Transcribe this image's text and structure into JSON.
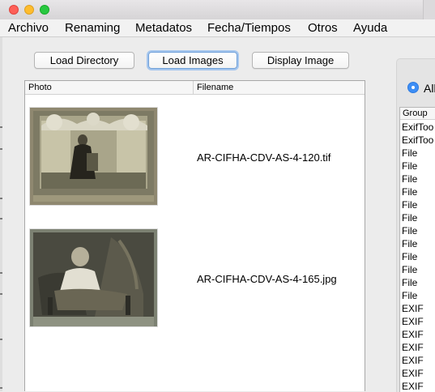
{
  "menubar": {
    "items": [
      "Archivo",
      "Renaming",
      "Metadatos",
      "Fecha/Tiempos",
      "Otros",
      "Ayuda"
    ]
  },
  "toolbar": {
    "load_directory": "Load Directory",
    "load_images": "Load Images",
    "display_image": "Display Image"
  },
  "table": {
    "columns": [
      "Photo",
      "Filename"
    ],
    "rows": [
      {
        "filename": "AR-CIFHA-CDV-AS-4-120.tif",
        "photo": "studio portrait of a seated woman in dark dress with floral frame"
      },
      {
        "filename": "AR-CIFHA-CDV-AS-4-165.jpg",
        "photo": "portrait of a child in white dress seated on a chair"
      }
    ]
  },
  "right_panel": {
    "radio_label": "All",
    "group_header": "Group",
    "groups": [
      "ExifToo",
      "ExifToo",
      "File",
      "File",
      "File",
      "File",
      "File",
      "File",
      "File",
      "File",
      "File",
      "File",
      "File",
      "File",
      "EXIF",
      "EXIF",
      "EXIF",
      "EXIF",
      "EXIF",
      "EXIF",
      "EXIF"
    ]
  },
  "colors": {
    "accent": "#3d8ef5",
    "focus_ring": "#a5c6ee"
  }
}
